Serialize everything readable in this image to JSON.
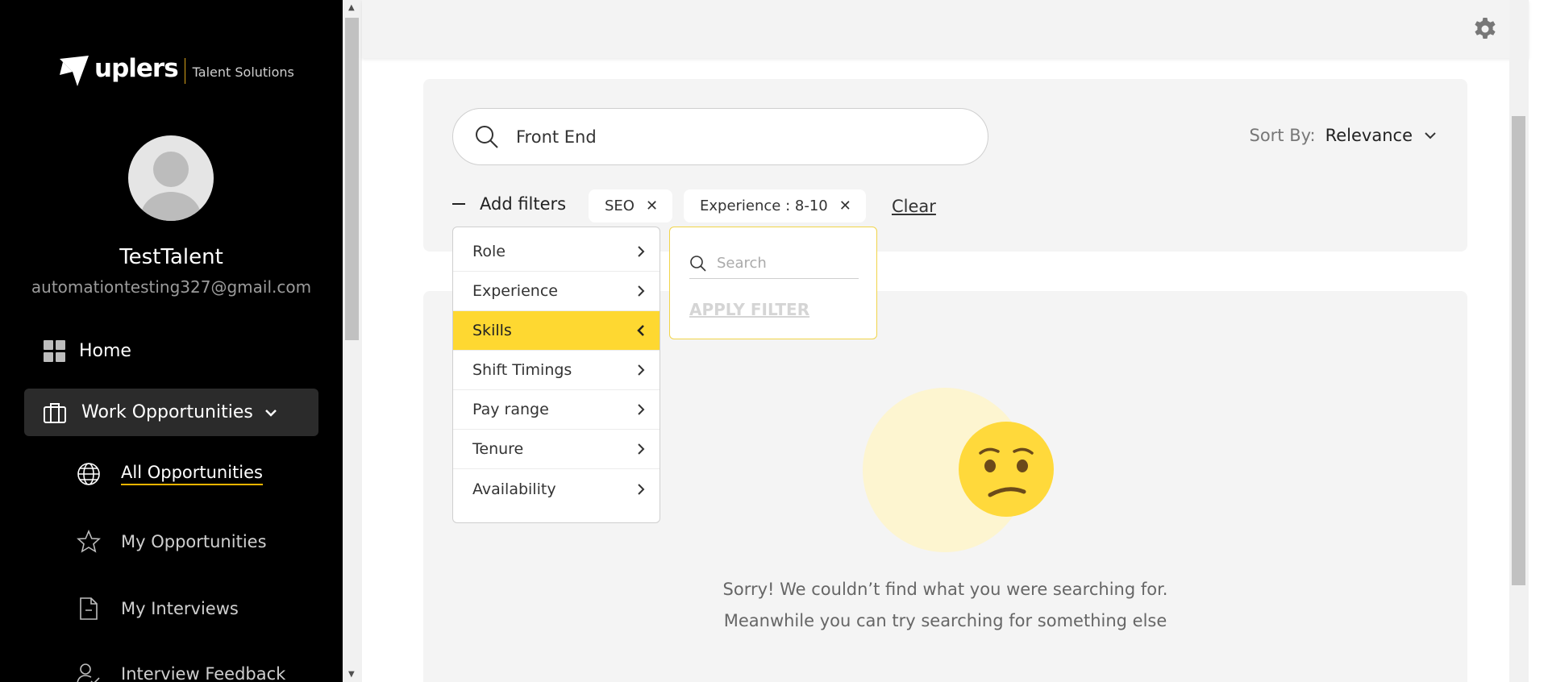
{
  "brand": {
    "name": "uplers",
    "tagline": "Talent Solutions"
  },
  "user": {
    "name": "TestTalent",
    "email": "automationtesting327@gmail.com"
  },
  "nav": {
    "home": "Home",
    "work": "Work Opportunities",
    "sub": {
      "all": "All Opportunities",
      "my": "My Opportunities",
      "interviews": "My Interviews",
      "feedback": "Interview Feedback"
    }
  },
  "search": {
    "value": "Front End"
  },
  "sort": {
    "label": "Sort By:",
    "value": "Relevance"
  },
  "filters": {
    "toggle_label": "Add filters",
    "chips": [
      "SEO",
      "Experience : 8-10"
    ],
    "clear_label": "Clear",
    "menu": [
      "Role",
      "Experience",
      "Skills",
      "Shift Timings",
      "Pay range",
      "Tenure",
      "Availability"
    ],
    "active": "Skills",
    "sub_search_placeholder": "Search",
    "apply_label": "APPLY FILTER"
  },
  "empty_state": {
    "line1": "Sorry! We couldn’t find what you were searching for.",
    "line2": "Meanwhile you can try searching for something else"
  },
  "colors": {
    "accent": "#fed831",
    "sidebar": "#000000",
    "underline": "#f0b400"
  }
}
